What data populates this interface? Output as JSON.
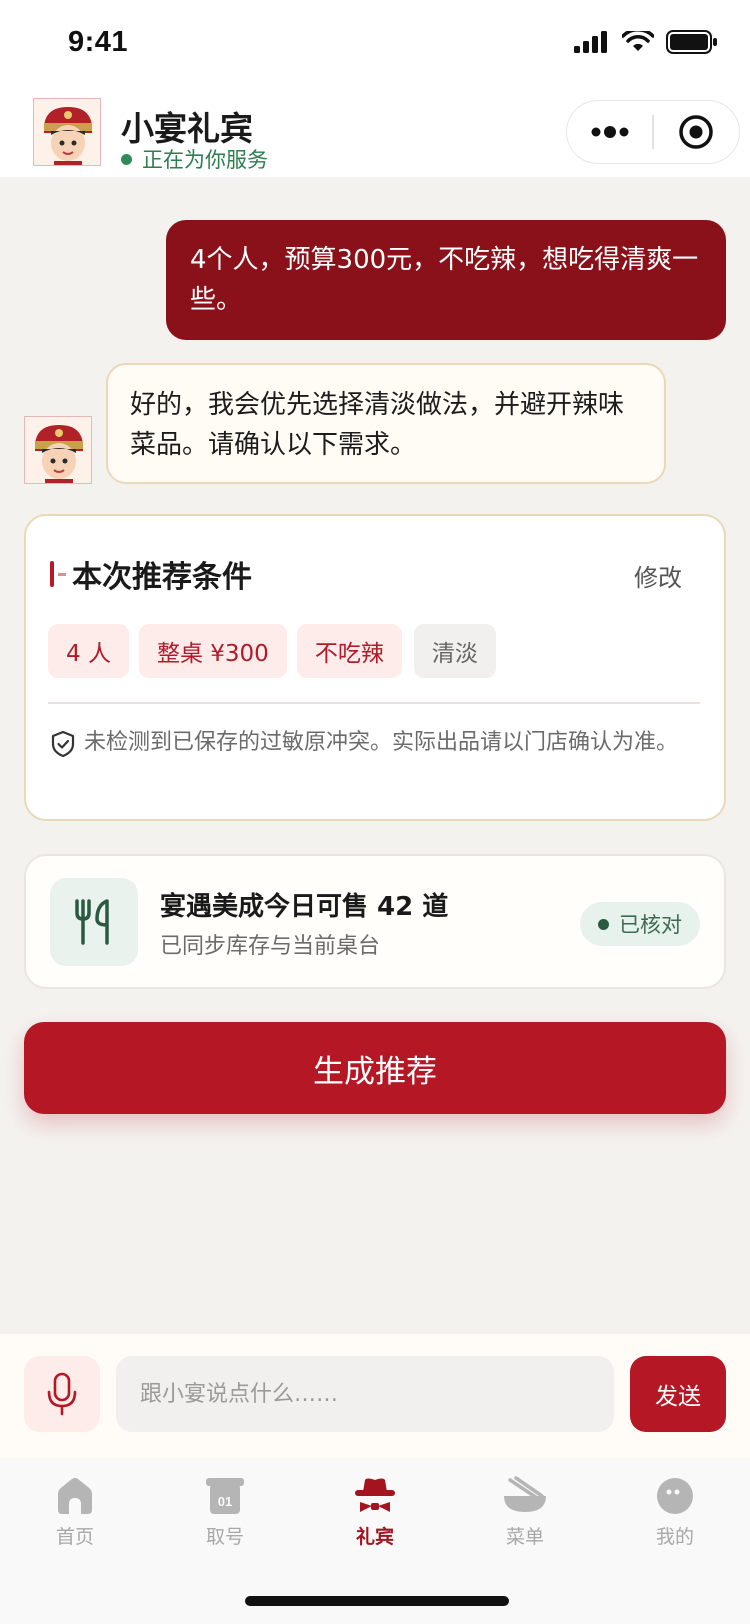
{
  "status_bar": {
    "time": "9:41",
    "icons": [
      "signal-icon",
      "wifi-icon",
      "battery-icon"
    ]
  },
  "header": {
    "title": "小宴礼宾",
    "status": "正在为你服务",
    "status_color": "#2e8b57",
    "capsule_icons": [
      "more-icon",
      "target-icon"
    ]
  },
  "chat": {
    "user_message": "4个人，预算300元，不吃辣，想吃得清爽一些。",
    "bot_message": "好的，我会优先选择清淡做法，并避开辣味菜品。请确认以下需求。"
  },
  "criteria": {
    "title": "本次推荐条件",
    "edit_label": "修改",
    "tags": [
      "4 人",
      "整桌 ¥300",
      "不吃辣",
      "清淡"
    ],
    "note": "未检测到已保存的过敏原冲突。实际出品请以门店确认为准。"
  },
  "inventory": {
    "title": "宴遇美成今日可售 42 道",
    "subtitle": "已同步库存与当前桌台",
    "verified_label": "已核对"
  },
  "generate_button": "生成推荐",
  "input_bar": {
    "placeholder": "跟小宴说点什么……",
    "send_label": "发送"
  },
  "tab_bar": {
    "active_index": 2,
    "tabs": [
      {
        "label": "首页",
        "icon": "home-icon"
      },
      {
        "label": "取号",
        "icon": "ticket-icon"
      },
      {
        "label": "礼宾",
        "icon": "concierge-icon"
      },
      {
        "label": "菜单",
        "icon": "bowl-icon"
      },
      {
        "label": "我的",
        "icon": "profile-icon"
      }
    ]
  },
  "colors": {
    "brand_red": "#b51724",
    "user_bubble": "#8a1119",
    "accent_green": "#2e8b57"
  }
}
